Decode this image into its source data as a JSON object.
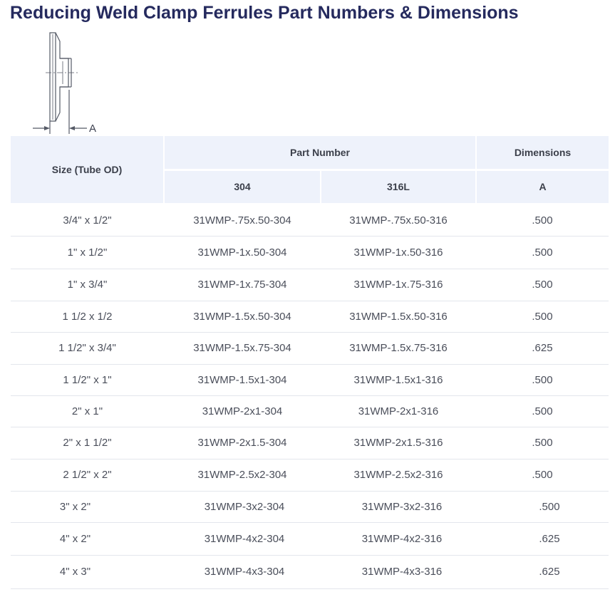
{
  "page": {
    "title": "Reducing Weld Clamp Ferrules Part Numbers & Dimensions"
  },
  "diagram": {
    "dimension_label": "A"
  },
  "table": {
    "headers": {
      "size": "Size (Tube OD)",
      "part_number": "Part Number",
      "dimensions": "Dimensions",
      "col_304": "304",
      "col_316l": "316L",
      "col_a": "A"
    },
    "rows": [
      {
        "size": "3/4\" x 1/2\"",
        "p304": "31WMP-.75x.50-304",
        "p316": "31WMP-.75x.50-316",
        "a": ".500"
      },
      {
        "size": "1\" x 1/2\"",
        "p304": "31WMP-1x.50-304",
        "p316": "31WMP-1x.50-316",
        "a": ".500"
      },
      {
        "size": "1\" x 3/4\"",
        "p304": "31WMP-1x.75-304",
        "p316": "31WMP-1x.75-316",
        "a": ".500"
      },
      {
        "size": "1 1/2 x 1/2",
        "p304": "31WMP-1.5x.50-304",
        "p316": "31WMP-1.5x.50-316",
        "a": ".500"
      },
      {
        "size": "1 1/2\" x 3/4\"",
        "p304": "31WMP-1.5x.75-304",
        "p316": "31WMP-1.5x.75-316",
        "a": ".625"
      },
      {
        "size": "1 1/2\" x 1\"",
        "p304": "31WMP-1.5x1-304",
        "p316": "31WMP-1.5x1-316",
        "a": ".500"
      },
      {
        "size": "2\" x 1\"",
        "p304": "31WMP-2x1-304",
        "p316": "31WMP-2x1-316",
        "a": ".500"
      },
      {
        "size": "2\" x 1 1/2\"",
        "p304": "31WMP-2x1.5-304",
        "p316": "31WMP-2x1.5-316",
        "a": ".500"
      },
      {
        "size": "2 1/2\" x 2\"",
        "p304": "31WMP-2.5x2-304",
        "p316": "31WMP-2.5x2-316",
        "a": ".500"
      },
      {
        "size": "3\" x 2\"",
        "p304": "31WMP-3x2-304",
        "p316": "31WMP-3x2-316",
        "a": ".500"
      },
      {
        "size": "4\" x 2\"",
        "p304": "31WMP-4x2-304",
        "p316": "31WMP-4x2-316",
        "a": ".625"
      },
      {
        "size": "4\" x 3\"",
        "p304": "31WMP-4x3-304",
        "p316": "31WMP-4x3-316",
        "a": ".625"
      }
    ]
  }
}
